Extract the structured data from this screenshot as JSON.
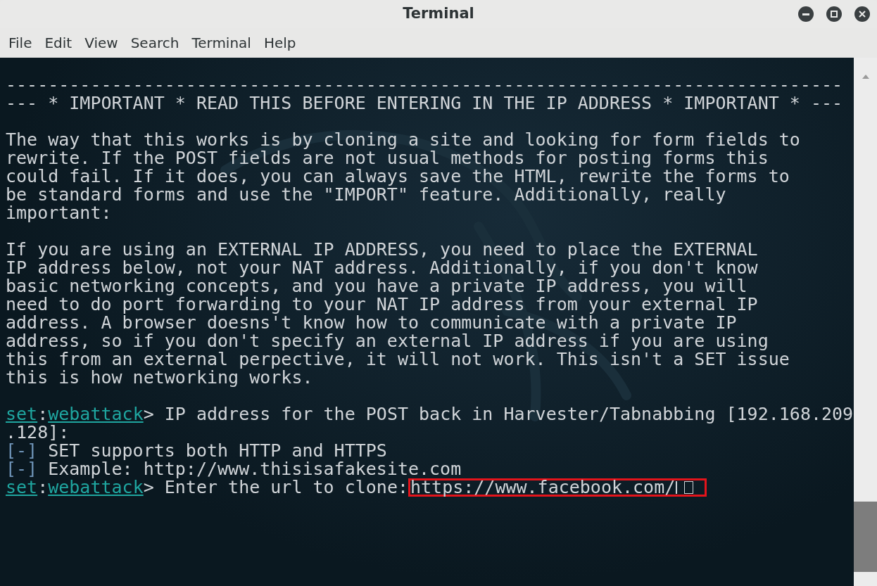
{
  "window": {
    "title": "Terminal"
  },
  "menu": [
    "File",
    "Edit",
    "View",
    "Search",
    "Terminal",
    "Help"
  ],
  "lines": [
    {
      "kind": "blank"
    },
    {
      "kind": "text",
      "text": "-------------------------------------------------------------------------------"
    },
    {
      "kind": "text",
      "text": "--- * IMPORTANT * READ THIS BEFORE ENTERING IN THE IP ADDRESS * IMPORTANT * ---"
    },
    {
      "kind": "blank"
    },
    {
      "kind": "text",
      "text": "The way that this works is by cloning a site and looking for form fields to"
    },
    {
      "kind": "text",
      "text": "rewrite. If the POST fields are not usual methods for posting forms this"
    },
    {
      "kind": "text",
      "text": "could fail. If it does, you can always save the HTML, rewrite the forms to"
    },
    {
      "kind": "text",
      "text": "be standard forms and use the \"IMPORT\" feature. Additionally, really"
    },
    {
      "kind": "text",
      "text": "important:"
    },
    {
      "kind": "blank"
    },
    {
      "kind": "text",
      "text": "If you are using an EXTERNAL IP ADDRESS, you need to place the EXTERNAL"
    },
    {
      "kind": "text",
      "text": "IP address below, not your NAT address. Additionally, if you don't know"
    },
    {
      "kind": "text",
      "text": "basic networking concepts, and you have a private IP address, you will"
    },
    {
      "kind": "text",
      "text": "need to do port forwarding to your NAT IP address from your external IP"
    },
    {
      "kind": "text",
      "text": "address. A browser doesns't know how to communicate with a private IP"
    },
    {
      "kind": "text",
      "text": "address, so if you don't specify an external IP address if you are using"
    },
    {
      "kind": "text",
      "text": "this from an external perpective, it will not work. This isn't a SET issue"
    },
    {
      "kind": "text",
      "text": "this is how networking works."
    },
    {
      "kind": "blank"
    },
    {
      "kind": "prompt",
      "host": "set",
      "separator": ":",
      "module": "webattack",
      "arrow": ">",
      "text": " IP address for the POST back in Harvester/Tabnabbing [192.168.209"
    },
    {
      "kind": "text",
      "text": ".128]:"
    },
    {
      "kind": "info",
      "marker": "[-]",
      "text": " SET supports both HTTP and HTTPS"
    },
    {
      "kind": "info",
      "marker": "[-]",
      "text": " Example: http://www.thisisafakesite.com"
    },
    {
      "kind": "prompt",
      "host": "set",
      "separator": ":",
      "module": "webattack",
      "arrow": ">",
      "text": " Enter the url to clone:",
      "input": "https://www.facebook.com/",
      "highlighted": true
    }
  ]
}
